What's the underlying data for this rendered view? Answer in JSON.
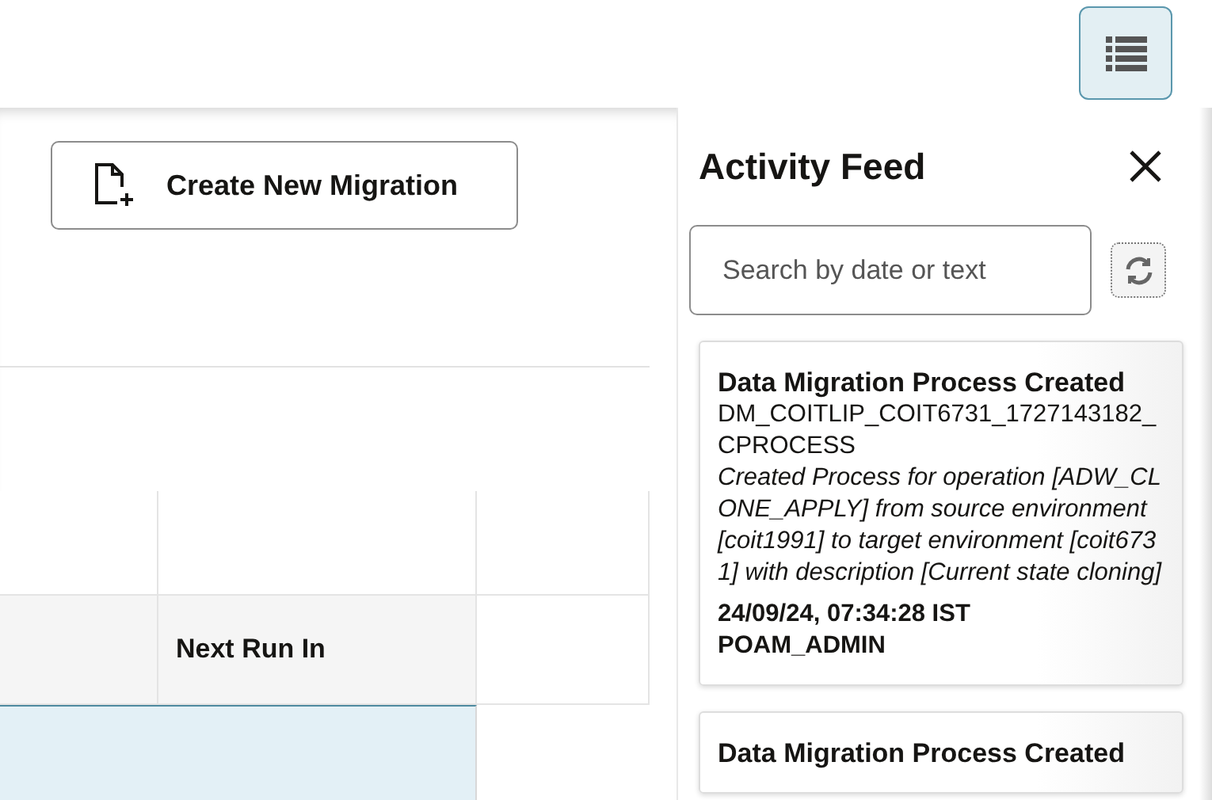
{
  "toolbar": {
    "feed_toggle": {
      "selected": true
    }
  },
  "main": {
    "create_button": "Create New Migration",
    "table": {
      "column_2": {
        "heading": "Next Run In"
      },
      "rows": [
        {
          "selected": true
        }
      ]
    }
  },
  "activity_feed": {
    "title": "Activity Feed",
    "search": {
      "placeholder": "Search by date or text"
    },
    "entries": [
      {
        "title": "Data Migration Process Created",
        "object": "DM_COITLIP_COIT6731_1727143182_CPROCESS",
        "description": "Created Process for operation [ADW_CLONE_APPLY] from source environment [coit1991] to target environment [coit6731] with description [Current state cloning]",
        "timestamp": "24/09/24, 07:34:28 IST",
        "user": "POAM_ADMIN"
      },
      {
        "title": "Data Migration Process Created"
      }
    ]
  }
}
